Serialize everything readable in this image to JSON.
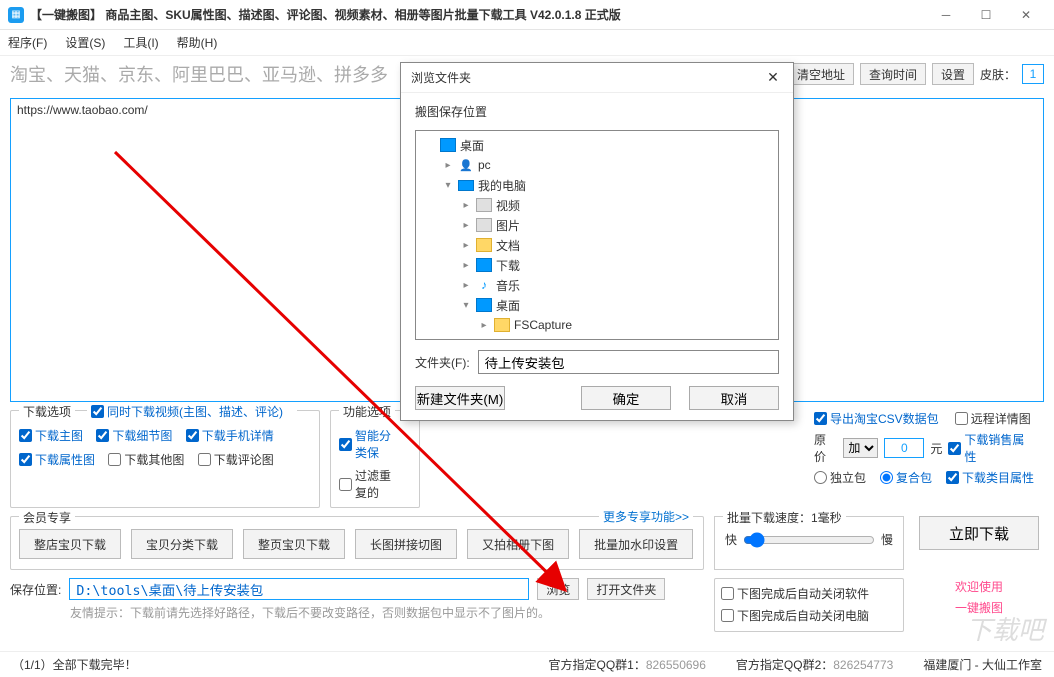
{
  "title": "【一键搬图】 商品主图、SKU属性图、描述图、评论图、视频素材、相册等图片批量下载工具 V42.0.1.8 正式版",
  "menu": {
    "program": "程序(F)",
    "settings": "设置(S)",
    "tools": "工具(I)",
    "help": "帮助(H)"
  },
  "keywords": "淘宝、天猫、京东、阿里巴巴、亚马逊、拼多多",
  "topbtns": {
    "clear": "清空地址",
    "querytime": "查询时间",
    "settings": "设置",
    "skinlabel": "皮肤：",
    "skin": "1"
  },
  "url": "https://www.taobao.com/",
  "download_options": {
    "title": "下载选项",
    "sync_video": "同时下载视频(主图、描述、评论)",
    "main": "下载主图",
    "detail": "下载细节图",
    "mobile": "下载手机详情",
    "attr": "下载属性图",
    "other": "下载其他图",
    "comment": "下载评论图"
  },
  "func_options": {
    "title": "功能选项",
    "smart": "智能分类保",
    "filter": "过滤重复的"
  },
  "right_options": {
    "csv": "导出淘宝CSV数据包",
    "remote": "远程详情图",
    "origprice": "原价",
    "op": "加",
    "val": "0",
    "unit": "元",
    "saleattr": "下载销售属性",
    "single": "独立包",
    "combo": "复合包",
    "catattr": "下载类目属性"
  },
  "member": {
    "title": "会员专享",
    "more": "更多专享功能>>",
    "b1": "整店宝贝下载",
    "b2": "宝贝分类下载",
    "b3": "整页宝贝下载",
    "b4": "长图拼接切图",
    "b5": "又拍相册下图",
    "b6": "批量加水印设置"
  },
  "speed": {
    "title": "批量下载速度：1毫秒",
    "fast": "快",
    "slow": "慢"
  },
  "auto": {
    "closeapp": "下图完成后自动关闭软件",
    "shutdown": "下图完成后自动关闭电脑"
  },
  "go": "立即下载",
  "welcome": {
    "l1": "欢迎使用",
    "l2": "一键搬图"
  },
  "save": {
    "label": "保存位置:",
    "path": "D:\\tools\\桌面\\待上传安装包",
    "browse": "浏览",
    "open": "打开文件夹",
    "tip": "友情提示：下载前请先选择好路径，下载后不要改变路径，否则数据包中显示不了图片的。"
  },
  "status": {
    "done": "（1/1）全部下载完毕！",
    "qq1l": "官方指定QQ群1：",
    "qq1": "826550696",
    "qq2l": "官方指定QQ群2：",
    "qq2": "826254773",
    "loc": "福建厦门 - 大仙工作室"
  },
  "dialog": {
    "title": "浏览文件夹",
    "subtitle": "搬图保存位置",
    "tree": [
      {
        "d": 0,
        "exp": "",
        "ic": "desktop",
        "txt": "桌面"
      },
      {
        "d": 1,
        "exp": "▸",
        "ic": "pc",
        "txt": "pc"
      },
      {
        "d": 1,
        "exp": "▾",
        "ic": "computer",
        "txt": "我的电脑"
      },
      {
        "d": 2,
        "exp": "▸",
        "ic": "video",
        "txt": "视频"
      },
      {
        "d": 2,
        "exp": "▸",
        "ic": "video",
        "txt": "图片"
      },
      {
        "d": 2,
        "exp": "▸",
        "ic": "folder",
        "txt": "文档"
      },
      {
        "d": 2,
        "exp": "▸",
        "ic": "download",
        "txt": "下载"
      },
      {
        "d": 2,
        "exp": "▸",
        "ic": "music",
        "txt": "音乐"
      },
      {
        "d": 2,
        "exp": "▾",
        "ic": "desktop",
        "txt": "桌面"
      },
      {
        "d": 3,
        "exp": "▸",
        "ic": "folder",
        "txt": "FSCapture"
      }
    ],
    "namelabel": "文件夹(F):",
    "nameval": "待上传安装包",
    "newfolder": "新建文件夹(M)",
    "ok": "确定",
    "cancel": "取消"
  }
}
